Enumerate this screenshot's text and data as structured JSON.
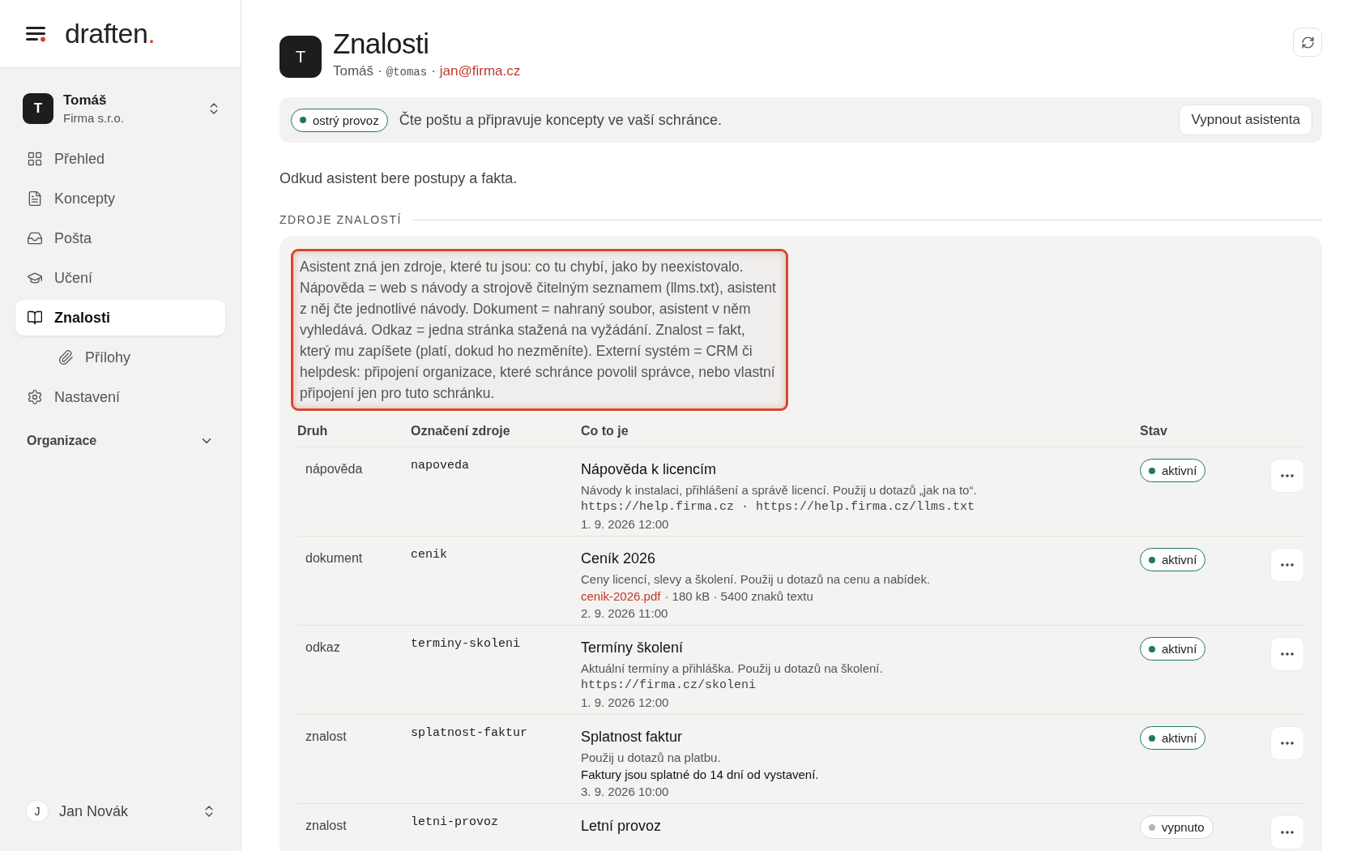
{
  "sidebar": {
    "logo": {
      "text": "draften",
      "dot": "."
    },
    "workspace": {
      "initial": "T",
      "name": "Tomáš",
      "org": "Firma s.r.o."
    },
    "items": [
      {
        "label": "Přehled",
        "selected": false
      },
      {
        "label": "Koncepty",
        "selected": false
      },
      {
        "label": "Pošta",
        "selected": false
      },
      {
        "label": "Učení",
        "selected": false
      },
      {
        "label": "Znalosti",
        "selected": true,
        "children": [
          {
            "label": "Přílohy",
            "selected": false
          }
        ]
      },
      {
        "label": "Nastavení",
        "selected": false
      }
    ],
    "section": {
      "label": "Organizace",
      "expanded": false
    },
    "user": {
      "initial": "J",
      "name": "Jan Novák"
    }
  },
  "header": {
    "initial": "T",
    "title": "Znalosti",
    "name": "Tomáš",
    "handle": "@tomas",
    "separator": "·",
    "email": "jan@firma.cz"
  },
  "status": {
    "badge": "ostrý provoz",
    "on": true,
    "text": "Čte poštu a připravuje koncepty ve vaší schránce.",
    "button": "Vypnout asistenta"
  },
  "subtitle": "Odkud asistent bere postupy a fakta.",
  "section_title": "ZDROJE ZNALOSTÍ",
  "note": "Asistent zná jen zdroje, které tu jsou: co tu chybí, jako by neexistovalo. Nápověda = web s návody a strojově čitelným seznamem (llms.txt), asistent z něj čte jednotlivé návody. Dokument = nahraný soubor, asistent v něm vyhledává. Odkaz = jedna stránka stažená na vyžádání. Znalost = fakt, který mu zapíšete (platí, dokud ho nezměníte). Externí systém = CRM či helpdesk: připojení organizace, které schránce povolil správce, nebo vlastní připojení jen pro tuto schránku.",
  "table": {
    "columns": [
      "Druh",
      "Označení zdroje",
      "Co to je",
      "Stav"
    ],
    "rows": [
      {
        "kind": "nápověda",
        "id": "napoveda",
        "title": "Nápověda k licencím",
        "lines": [
          {
            "kind": "text",
            "text": "Návody k instalaci, přihlášení a správě licencí. Použij u dotazů „jak na to“."
          },
          {
            "kind": "mono",
            "text": "https://help.firma.cz · https://help.firma.cz/llms.txt"
          },
          {
            "kind": "text",
            "text": "1. 9. 2026 12:00"
          }
        ],
        "status": "aktivní",
        "active": true
      },
      {
        "kind": "dokument",
        "id": "cenik",
        "title": "Ceník 2026",
        "lines": [
          {
            "kind": "text",
            "text": "Ceny licencí, slevy a školení. Použij u dotazů na cenu a nabídek."
          },
          {
            "kind": "file",
            "link": "cenik-2026.pdf",
            "text": "· 180 kB · 5400 znaků textu"
          },
          {
            "kind": "text",
            "text": "2. 9. 2026 11:00"
          }
        ],
        "status": "aktivní",
        "active": true
      },
      {
        "kind": "odkaz",
        "id": "terminy-skoleni",
        "title": "Termíny školení",
        "lines": [
          {
            "kind": "text",
            "text": "Aktuální termíny a přihláška. Použij u dotazů na školení."
          },
          {
            "kind": "mono",
            "text": "https://firma.cz/skoleni"
          },
          {
            "kind": "text",
            "text": "1. 9. 2026 12:00"
          }
        ],
        "status": "aktivní",
        "active": true
      },
      {
        "kind": "znalost",
        "id": "splatnost-faktur",
        "title": "Splatnost faktur",
        "lines": [
          {
            "kind": "text",
            "text": "Použij u dotazů na platbu."
          },
          {
            "kind": "strong",
            "text": "Faktury jsou splatné do 14 dní od vystavení."
          },
          {
            "kind": "text",
            "text": "3. 9. 2026 10:00"
          }
        ],
        "status": "aktivní",
        "active": true
      },
      {
        "kind": "znalost",
        "id": "letni-provoz",
        "title": "Letní provoz",
        "lines": [],
        "status": "vypnuto",
        "active": false
      }
    ]
  }
}
